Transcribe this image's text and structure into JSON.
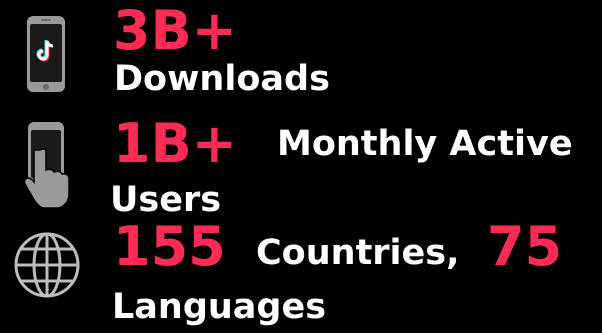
{
  "stats": [
    {
      "icon": "tiktok-phone-icon",
      "value": "3B+",
      "label": "Downloads"
    },
    {
      "icon": "touch-phone-icon",
      "value": "1B+",
      "label_line1": "Monthly Active",
      "label_line2": "Users"
    },
    {
      "icon": "globe-icon",
      "value": "155",
      "label_line1": "Countries,",
      "value2": "75",
      "label_line2": "Languages"
    }
  ],
  "colors": {
    "accent": "#fe2c55",
    "text": "#ffffff",
    "background": "#000000",
    "icon": "#bdbdbd"
  }
}
